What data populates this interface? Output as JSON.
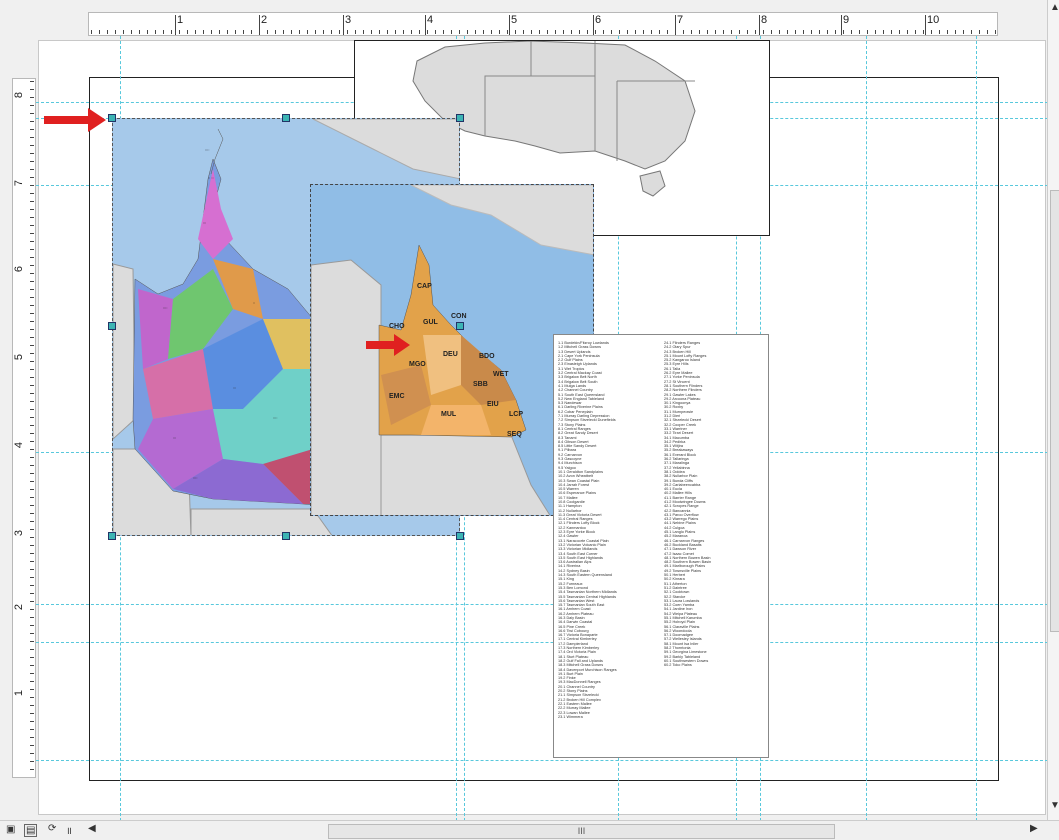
{
  "ruler": {
    "top_ticks": [
      "1",
      "2",
      "3",
      "4",
      "5",
      "6",
      "7",
      "8",
      "9",
      "10"
    ],
    "left_ticks": [
      "8",
      "7",
      "6",
      "5",
      "4",
      "3",
      "2",
      "1"
    ]
  },
  "regional_map": {
    "labels": [
      "CAP",
      "CHO",
      "GUL",
      "CON",
      "DEU",
      "MGO",
      "BDO",
      "EMC",
      "SBB",
      "WET",
      "MUL",
      "EIU",
      "LCP",
      "SEQ"
    ]
  },
  "legend": {
    "col1": [
      "1.1 Burdekin/Fitzroy Lowlands",
      "1.2 Mitchell Grass Downs",
      "1.3 Desert Uplands",
      "2.1 Cape York Peninsula",
      "2.2 Gulf Plains",
      "2.3 Einasleigh Uplands",
      "3.1 Wet Tropics",
      "3.2 Central Mackay Coast",
      "3.3 Brigalow Belt North",
      "3.4 Brigalow Belt South",
      "4.1 Mulga Lands",
      "4.2 Channel Country",
      "5.1 South East Queensland",
      "5.2 New England Tableland",
      "5.3 Nandewar",
      "6.1 Darling Riverine Plains",
      "6.2 Cobar Peneplain",
      "7.1 Murray Darling Depression",
      "7.2 Simpson Strzelecki Dunefields",
      "7.3 Stony Plains",
      "8.1 Central Ranges",
      "8.2 Great Sandy Desert",
      "8.3 Tanami",
      "8.4 Gibson Desert",
      "8.5 Little Sandy Desert",
      "9.1 Pilbara",
      "9.2 Carnarvon",
      "9.3 Gascoyne",
      "9.4 Murchison",
      "9.5 Yalgoo",
      "10.1 Geraldton Sandplains",
      "10.2 Avon Wheatbelt",
      "10.3 Swan Coastal Plain",
      "10.4 Jarrah Forest",
      "10.5 Warren",
      "10.6 Esperance Plains",
      "10.7 Mallee",
      "10.8 Coolgardie",
      "11.1 Hampton",
      "11.2 Nullarbor",
      "11.3 Great Victoria Desert",
      "11.4 Central Ranges",
      "12.1 Flinders Lofty Block",
      "12.2 Kanmantoo",
      "12.3 Eyre Yorke Block",
      "12.4 Gawler",
      "13.1 Naracoorte Coastal Plain",
      "13.2 Victorian Volcanic Plain",
      "13.3 Victorian Midlands",
      "13.4 South East Corner",
      "13.5 South East Highlands",
      "13.6 Australian Alps",
      "14.1 Riverina",
      "14.2 Sydney Basin",
      "14.3 South Eastern Queensland",
      "15.1 King",
      "15.2 Furneaux",
      "15.3 Ben Lomond",
      "15.4 Tasmanian Northern Midlands",
      "15.5 Tasmanian Central Highlands",
      "15.6 Tasmanian West",
      "15.7 Tasmanian South East",
      "16.1 Arnhem Coast",
      "16.2 Arnhem Plateau",
      "16.3 Daly Basin",
      "16.4 Darwin Coastal",
      "16.5 Pine Creek",
      "16.6 Tiwi Cobourg",
      "16.7 Victoria Bonaparte",
      "17.1 Central Kimberley",
      "17.2 Dampierland",
      "17.3 Northern Kimberley",
      "17.4 Ord Victoria Plain",
      "18.1 Sturt Plateau",
      "18.2 Gulf Fall and Uplands",
      "18.3 Mitchell Grass Downs",
      "18.4 Davenport Murchison Ranges",
      "19.1 Burt Plain",
      "19.2 Finke",
      "19.3 MacDonnell Ranges",
      "20.1 Channel Country",
      "20.2 Stony Plains",
      "21.1 Simpson Strzelecki",
      "21.2 Broken Hill Complex",
      "22.1 Eastern Mallee",
      "22.2 Murray Mallee",
      "22.3 Lowan Mallee",
      "23.1 Wimmera"
    ],
    "col2": [
      "24.1 Flinders Ranges",
      "24.2 Olary Spur",
      "24.3 Broken Hill",
      "25.1 Mount Lofty Ranges",
      "25.2 Kangaroo Island",
      "25.3 Eyre Hills",
      "26.1 Talia",
      "26.2 Eyre Mallee",
      "27.1 Yorke Peninsula",
      "27.2 St Vincent",
      "28.1 Southern Flinders",
      "28.2 Northern Flinders",
      "29.1 Gawler Lakes",
      "29.2 Arcoona Plateau",
      "30.1 Kingoonya",
      "30.2 Roxby",
      "31.1 Murnpeowie",
      "31.2 Dieri",
      "32.1 Strzelecki Desert",
      "32.2 Cooper Creek",
      "33.1 Warriner",
      "33.2 Tirari Desert",
      "34.1 Macumba",
      "34.2 Pedirka",
      "35.1 Witjira",
      "35.2 Breakaways",
      "36.1 Everard Block",
      "36.2 Tallaringa",
      "37.1 Maralinga",
      "37.2 Yellabinna",
      "38.1 Ooldea",
      "38.2 Nullarbor Plain",
      "39.1 Bunda Cliffs",
      "39.2 Carlabeencabba",
      "40.1 Eucla",
      "40.2 Mallee Hills",
      "41.1 Barrier Range",
      "41.2 Mootwingee Downs",
      "42.1 Scropes Range",
      "42.2 Bancannia",
      "43.1 Paroo Overflow",
      "43.2 Warrego Plains",
      "44.1 Nebine Plains",
      "44.2 Culgoa",
      "45.1 Langlo Plains",
      "45.2 Maranoa",
      "46.1 Carnarvon Ranges",
      "46.2 Buckland Basalts",
      "47.1 Dawson River",
      "47.2 Isaac Comet",
      "48.1 Northern Bowen Basin",
      "48.2 Southern Bowen Basin",
      "49.1 Marlborough Plains",
      "49.2 Townsville Plains",
      "50.1 Herbert",
      "50.2 Kinrara",
      "51.1 Atherton",
      "51.2 Daintree",
      "52.1 Cooktown",
      "52.2 Starcke",
      "53.1 Laura Lowlands",
      "53.2 Coen Yamba",
      "54.1 Jardine Iron",
      "54.2 Weipa Plateau",
      "55.1 Mitchell Karumba",
      "55.2 Holroyd Plain",
      "56.1 Claraville Plains",
      "56.2 Woondoola",
      "57.1 Doomadgee",
      "57.2 Wellesley Islands",
      "58.1 Mount Isa Inlier",
      "58.2 Thorntonia",
      "59.1 Georgina Limestone",
      "59.2 Barkly Tableland",
      "60.1 Southwestern Downs",
      "60.2 Toko Plains"
    ]
  },
  "status": {
    "scroll_label": "III"
  }
}
